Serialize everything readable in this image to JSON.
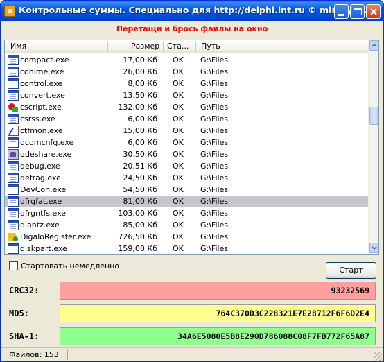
{
  "window": {
    "title": "Контрольные суммы. Специально для http://delphi.int.ru © min@y™..."
  },
  "drop_hint": "Перетащи и брось файлы на окно",
  "table": {
    "columns": [
      "Имя",
      "Размер",
      "Ста...",
      "Путь"
    ],
    "rows": [
      {
        "name": "compact.exe",
        "size": "17,00 Кб",
        "status": "OK",
        "path": "G:\\Files",
        "icon": "exe-icon"
      },
      {
        "name": "conime.exe",
        "size": "26,00 Кб",
        "status": "OK",
        "path": "G:\\Files",
        "icon": "exe-icon"
      },
      {
        "name": "control.exe",
        "size": "8,00 Кб",
        "status": "OK",
        "path": "G:\\Files",
        "icon": "exe-icon"
      },
      {
        "name": "convert.exe",
        "size": "13,50 Кб",
        "status": "OK",
        "path": "G:\\Files",
        "icon": "exe-icon"
      },
      {
        "name": "cscript.exe",
        "size": "132,00 Кб",
        "status": "OK",
        "path": "G:\\Files",
        "icon": "script-icon"
      },
      {
        "name": "csrss.exe",
        "size": "6,00 Кб",
        "status": "OK",
        "path": "G:\\Files",
        "icon": "exe-icon"
      },
      {
        "name": "ctfmon.exe",
        "size": "15,00 Кб",
        "status": "OK",
        "path": "G:\\Files",
        "icon": "pen-icon"
      },
      {
        "name": "dcomcnfg.exe",
        "size": "6,00 Кб",
        "status": "OK",
        "path": "G:\\Files",
        "icon": "exe-icon"
      },
      {
        "name": "ddeshare.exe",
        "size": "30,50 Кб",
        "status": "OK",
        "path": "G:\\Files",
        "icon": "share-icon"
      },
      {
        "name": "debug.exe",
        "size": "20,51 Кб",
        "status": "OK",
        "path": "G:\\Files",
        "icon": "exe-icon"
      },
      {
        "name": "defrag.exe",
        "size": "24,50 Кб",
        "status": "OK",
        "path": "G:\\Files",
        "icon": "exe-icon"
      },
      {
        "name": "DevCon.exe",
        "size": "54,50 Кб",
        "status": "OK",
        "path": "G:\\Files",
        "icon": "exe-icon"
      },
      {
        "name": "dfrgfat.exe",
        "size": "81,00 Кб",
        "status": "OK",
        "path": "G:\\Files",
        "icon": "exe-icon",
        "selected": true
      },
      {
        "name": "dfrgntfs.exe",
        "size": "103,00 Кб",
        "status": "OK",
        "path": "G:\\Files",
        "icon": "exe-icon"
      },
      {
        "name": "diantz.exe",
        "size": "85,00 Кб",
        "status": "OK",
        "path": "G:\\Files",
        "icon": "exe-icon"
      },
      {
        "name": "DigaloRegister.exe",
        "size": "726,50 Кб",
        "status": "OK",
        "path": "G:\\Files",
        "icon": "digalo-icon"
      },
      {
        "name": "diskpart.exe",
        "size": "159,00 Кб",
        "status": "OK",
        "path": "G:\\Files",
        "icon": "exe-icon"
      }
    ]
  },
  "start_immediately_label": "Стартовать немедленно",
  "start_button_label": "Старт",
  "hashes": {
    "crc32": {
      "label": "CRC32:",
      "value": "93232569",
      "color": "#ffa0a0"
    },
    "md5": {
      "label": "MD5:",
      "value": "764C370D3C228321E7E28712F6F6D2E4",
      "color": "#ffff90"
    },
    "sha1": {
      "label": "SHA-1:",
      "value": "34A6E5080E5B8E290D786088C08F7FB772F65A87",
      "color": "#90ff90"
    }
  },
  "status": {
    "files_count": "Файлов: 153"
  }
}
